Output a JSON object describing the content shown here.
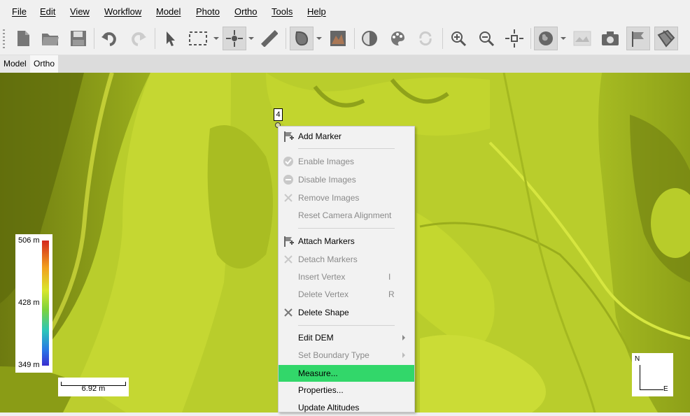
{
  "menu": [
    "File",
    "Edit",
    "View",
    "Workflow",
    "Model",
    "Photo",
    "Ortho",
    "Tools",
    "Help"
  ],
  "toolbar": {
    "icons": [
      "new-file-icon",
      "open-folder-icon",
      "save-icon",
      "undo-icon",
      "redo-icon",
      "select-pointer-icon",
      "rectangle-selection-icon",
      "navigation-icon",
      "ruler-icon",
      "draw-polygon-icon",
      "dem-view-icon",
      "shading-icon",
      "color-palette-icon",
      "reset-rotate-icon",
      "zoom-in-icon",
      "zoom-out-icon",
      "fit-view-icon",
      "globe-icon",
      "orthomosaic-icon",
      "camera-icon",
      "marker-flag-icon",
      "shape-icon"
    ]
  },
  "tabs": [
    "Model",
    "Ortho"
  ],
  "map": {
    "marker_label": "4",
    "legend": {
      "max": "506 m",
      "mid": "428 m",
      "min": "349 m"
    },
    "scale": "6.92 m",
    "compass": {
      "north": "N",
      "east": "E"
    }
  },
  "context_menu": {
    "items": [
      {
        "label": "Add Marker",
        "enabled": true,
        "icon": "add-marker-icon"
      },
      {
        "label": "Enable Images",
        "enabled": false,
        "icon": "check-circle-icon"
      },
      {
        "label": "Disable Images",
        "enabled": false,
        "icon": "minus-circle-icon"
      },
      {
        "label": "Remove Images",
        "enabled": false,
        "icon": "remove-x-icon"
      },
      {
        "label": "Reset Camera Alignment",
        "enabled": false,
        "icon": ""
      },
      {
        "label": "Attach Markers",
        "enabled": true,
        "icon": "attach-marker-icon"
      },
      {
        "label": "Detach Markers",
        "enabled": false,
        "icon": "detach-x-icon"
      },
      {
        "label": "Insert Vertex",
        "enabled": false,
        "shortcut": "I"
      },
      {
        "label": "Delete Vertex",
        "enabled": false,
        "shortcut": "R"
      },
      {
        "label": "Delete Shape",
        "enabled": true,
        "icon": "delete-x-icon"
      },
      {
        "label": "Edit DEM",
        "enabled": true,
        "submenu": true
      },
      {
        "label": "Set Boundary Type",
        "enabled": false,
        "submenu": true
      },
      {
        "label": "Measure...",
        "enabled": true,
        "highlighted": true
      },
      {
        "label": "Properties...",
        "enabled": true
      },
      {
        "label": "Update Altitudes",
        "enabled": true
      }
    ]
  },
  "colors": {
    "highlight": "#32d76a",
    "terrain": "#b7cc2a"
  }
}
